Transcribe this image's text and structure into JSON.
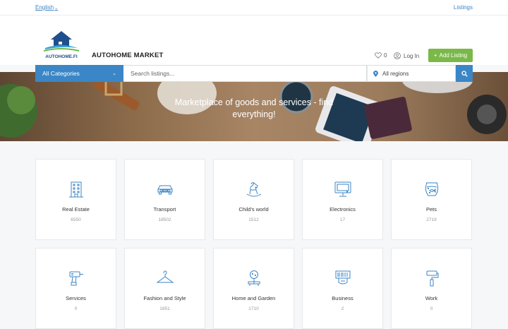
{
  "topbar": {
    "language": "English",
    "listings_link": "Listings"
  },
  "header": {
    "logo_text": "AUTOHOME.FI",
    "brand": "AUTOHOME MARKET",
    "favorites_count": "0",
    "login_label": "Log In",
    "add_listing_label": "Add Listing"
  },
  "search": {
    "category": "All Categories",
    "placeholder": "Search listings...",
    "region": "All regions"
  },
  "hero": {
    "tagline": "Marketplace of goods and services - find everything!"
  },
  "categories": [
    {
      "name": "Real Estate",
      "count": "6550",
      "icon": "building-icon"
    },
    {
      "name": "Transport",
      "count": "18502",
      "icon": "car-icon"
    },
    {
      "name": "Child's world",
      "count": "1512",
      "icon": "rocking-horse-icon"
    },
    {
      "name": "Electronics",
      "count": "17",
      "icon": "monitor-icon"
    },
    {
      "name": "Pets",
      "count": "2719",
      "icon": "fishbowl-icon"
    },
    {
      "name": "Services",
      "count": "0",
      "icon": "drill-icon"
    },
    {
      "name": "Fashion and Style",
      "count": "1851",
      "icon": "hanger-icon"
    },
    {
      "name": "Home and Garden",
      "count": "1710",
      "icon": "lamp-icon"
    },
    {
      "name": "Business",
      "count": "2",
      "icon": "barcode-icon"
    },
    {
      "name": "Work",
      "count": "0",
      "icon": "paint-roller-icon"
    }
  ],
  "colors": {
    "accent": "#3b86c6",
    "add_button": "#7bb84a"
  }
}
